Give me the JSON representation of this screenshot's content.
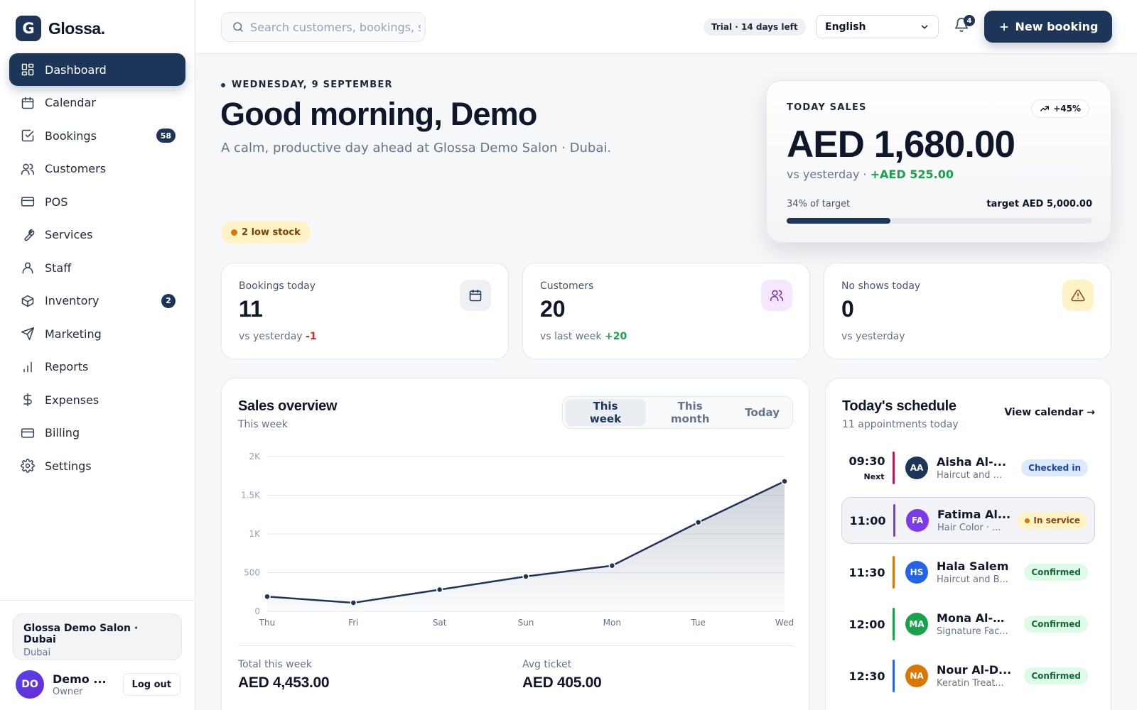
{
  "brand": {
    "initial": "G",
    "name": "Glossa."
  },
  "sidebar": {
    "items": [
      {
        "label": "Dashboard",
        "icon": "dashboard-icon"
      },
      {
        "label": "Calendar",
        "icon": "calendar-icon"
      },
      {
        "label": "Bookings",
        "icon": "checkbox-icon",
        "badge": "58"
      },
      {
        "label": "Customers",
        "icon": "users-icon"
      },
      {
        "label": "POS",
        "icon": "card-icon"
      },
      {
        "label": "Services",
        "icon": "wrench-icon"
      },
      {
        "label": "Staff",
        "icon": "user-icon"
      },
      {
        "label": "Inventory",
        "icon": "box-icon",
        "badge": "2"
      },
      {
        "label": "Marketing",
        "icon": "send-icon"
      },
      {
        "label": "Reports",
        "icon": "bar-chart-icon"
      },
      {
        "label": "Expenses",
        "icon": "dollar-icon"
      },
      {
        "label": "Billing",
        "icon": "card-icon"
      },
      {
        "label": "Settings",
        "icon": "gear-icon"
      }
    ],
    "active": "Dashboard",
    "salon_name": "Glossa Demo Salon · Dubai",
    "salon_city": "Dubai",
    "user_initials": "DO",
    "user_name": "Demo ...",
    "user_role": "Owner",
    "logout_label": "Log out"
  },
  "topbar": {
    "search_placeholder": "Search customers, bookings, s",
    "trial": "Trial · 14 days left",
    "language": "English",
    "notifications": "4",
    "new_booking": "New booking"
  },
  "hero": {
    "date": "WEDNESDAY, 9 SEPTEMBER",
    "greeting": "Good morning, Demo",
    "subtitle": "A calm, productive day ahead at Glossa Demo Salon · Dubai.",
    "low_stock": "2 low stock"
  },
  "today_sales": {
    "label": "TODAY SALES",
    "change": "+45%",
    "amount": "AED 1,680.00",
    "compare_prefix": "vs yesterday · ",
    "compare_value": "+AED 525.00",
    "progress_text": "34% of target",
    "progress_fraction": 0.34,
    "target": "target AED 5,000.00"
  },
  "stats": [
    {
      "label": "Bookings today",
      "value": "11",
      "compare_prefix": "vs yesterday ",
      "compare_value": "-1",
      "icon": "calendar-icon",
      "icon_bg": "#eef0f3",
      "icon_color": "#1c3558"
    },
    {
      "label": "Customers",
      "value": "20",
      "compare_prefix": "vs last week ",
      "compare_value": "+20",
      "icon": "users-icon",
      "icon_bg": "#f3e8ff",
      "icon_color": "#7e22ce"
    },
    {
      "label": "No shows today",
      "value": "0",
      "compare_prefix": "vs yesterday",
      "compare_value": "",
      "icon": "warning-icon",
      "icon_bg": "#fef3c7",
      "icon_color": "#92400e"
    }
  ],
  "sales_overview": {
    "title": "Sales overview",
    "subtitle": "This week",
    "tabs": [
      "This week",
      "This month",
      "Today"
    ],
    "active_tab": "This week",
    "total_label": "Total this week",
    "total_value": "AED 4,453.00",
    "avg_label": "Avg ticket",
    "avg_value": "AED 405.00"
  },
  "chart_data": {
    "type": "area",
    "categories": [
      "Thu",
      "Fri",
      "Sat",
      "Sun",
      "Mon",
      "Tue",
      "Wed"
    ],
    "values": [
      190,
      110,
      280,
      450,
      590,
      1150,
      1680
    ],
    "ylim": [
      0,
      2000
    ],
    "yticks": [
      0,
      500,
      1000,
      1500,
      2000
    ],
    "ytick_labels": [
      "0",
      "500",
      "1K",
      "1.5K",
      "2K"
    ],
    "grid": true,
    "line_color": "#1c3558"
  },
  "schedule": {
    "title": "Today's schedule",
    "subtitle": "11 appointments today",
    "view_calendar": "View calendar →",
    "appointments": [
      {
        "time": "09:30",
        "tag": "Next",
        "initials": "AA",
        "name": "Aisha Al-...",
        "service": "Haircut and ...",
        "status": "Checked in",
        "status_kind": "checked",
        "bar_color": "#be185d",
        "avatar_color": "#1c3558"
      },
      {
        "time": "11:00",
        "tag": "",
        "initials": "FA",
        "name": "Fatima Al...",
        "service": "Hair Color · ...",
        "status": "In service",
        "status_kind": "service",
        "bar_color": "#7c3aed",
        "avatar_color": "#7c3aed"
      },
      {
        "time": "11:30",
        "tag": "",
        "initials": "HS",
        "name": "Hala Salem",
        "service": "Haircut and B...",
        "status": "Confirmed",
        "status_kind": "confirmed",
        "bar_color": "#d97706",
        "avatar_color": "#2563eb"
      },
      {
        "time": "12:00",
        "tag": "",
        "initials": "MA",
        "name": "Mona Al-H...",
        "service": "Signature Fac...",
        "status": "Confirmed",
        "status_kind": "confirmed",
        "bar_color": "#16a34a",
        "avatar_color": "#16a34a"
      },
      {
        "time": "12:30",
        "tag": "",
        "initials": "NA",
        "name": "Nour Al-D...",
        "service": "Keratin Treat...",
        "status": "Confirmed",
        "status_kind": "confirmed",
        "bar_color": "#2563eb",
        "avatar_color": "#d97706"
      }
    ]
  }
}
